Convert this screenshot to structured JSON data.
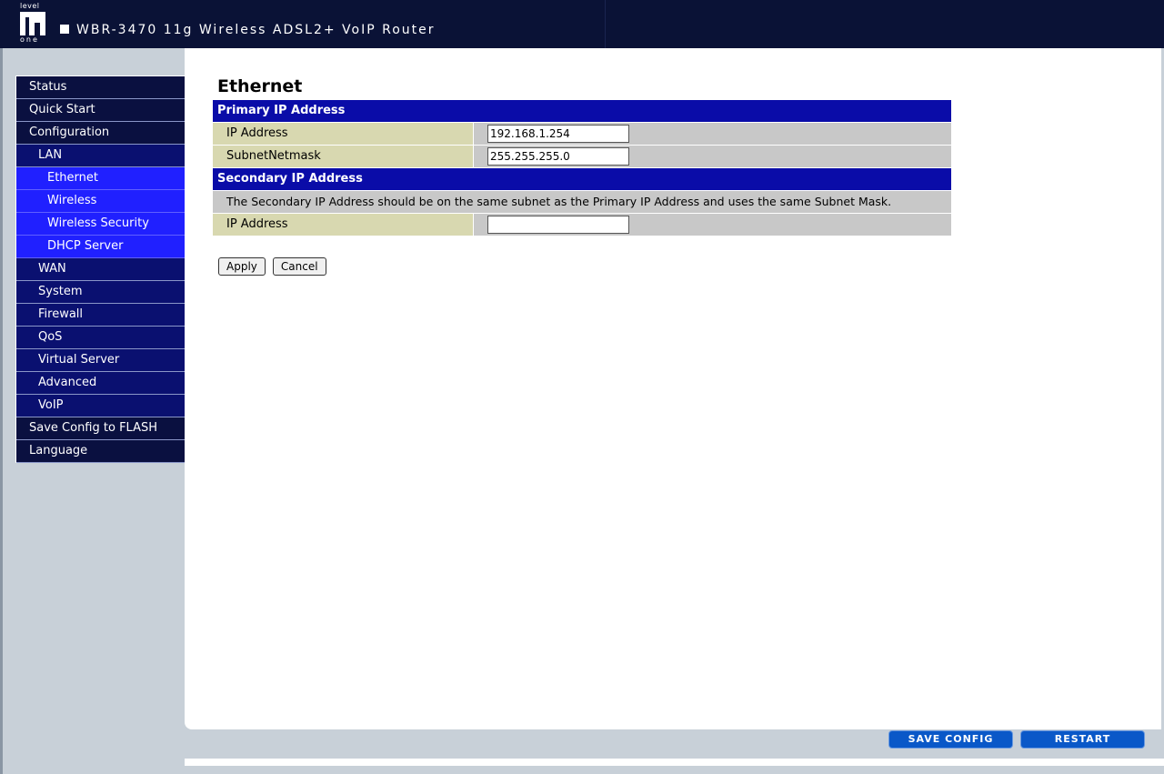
{
  "header": {
    "logo_top": "level",
    "logo_bottom": "one",
    "title": "WBR-3470 11g Wireless ADSL2+ VoIP Router"
  },
  "sidebar": {
    "items": [
      {
        "label": "Status",
        "level": 0
      },
      {
        "label": "Quick Start",
        "level": 0
      },
      {
        "label": "Configuration",
        "level": 0
      },
      {
        "label": "LAN",
        "level": 1
      },
      {
        "label": "Ethernet",
        "level": 2
      },
      {
        "label": "Wireless",
        "level": 2
      },
      {
        "label": "Wireless Security",
        "level": 2
      },
      {
        "label": "DHCP Server",
        "level": 2
      },
      {
        "label": "WAN",
        "level": 1
      },
      {
        "label": "System",
        "level": 1
      },
      {
        "label": "Firewall",
        "level": 1
      },
      {
        "label": "QoS",
        "level": 1
      },
      {
        "label": "Virtual Server",
        "level": 1
      },
      {
        "label": "Advanced",
        "level": 1
      },
      {
        "label": "VoIP",
        "level": 1
      },
      {
        "label": "Save Config to FLASH",
        "level": 0
      },
      {
        "label": "Language",
        "level": 0
      }
    ]
  },
  "page": {
    "title": "Ethernet",
    "primary": {
      "heading": "Primary IP Address",
      "ip_label": "IP Address",
      "ip_value": "192.168.1.254",
      "mask_label": "SubnetNetmask",
      "mask_value": "255.255.255.0"
    },
    "secondary": {
      "heading": "Secondary IP Address",
      "note": "The Secondary IP Address should be on the same subnet as the Primary IP Address and uses the same Subnet Mask.",
      "ip_label": "IP Address",
      "ip_value": ""
    },
    "buttons": {
      "apply": "Apply",
      "cancel": "Cancel"
    }
  },
  "footer": {
    "save_config": "SAVE CONFIG",
    "restart": "RESTART"
  }
}
